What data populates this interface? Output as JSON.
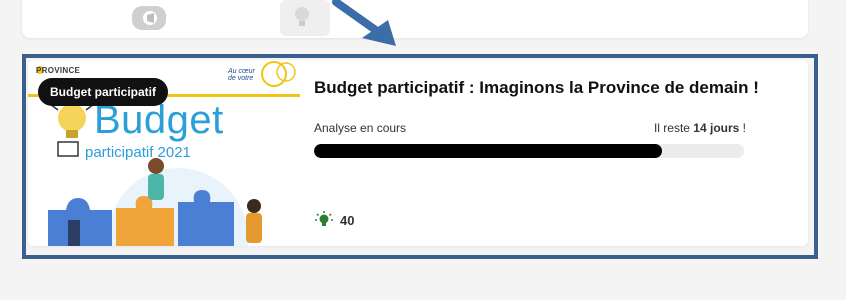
{
  "card": {
    "tag": "Budget participatif",
    "thumbnail": {
      "brand_left": "PROVINCE",
      "brand_right_line1": "Au cœur",
      "brand_right_line2": "de votre",
      "headline": "Budget",
      "subline": "participatif 2021"
    },
    "title": "Budget participatif : Imaginons la Province de demain !",
    "status": "Analyse en cours",
    "remaining_prefix": "Il reste ",
    "remaining_days": "14 jours",
    "remaining_suffix": " !",
    "progress": 0.81,
    "votes_icon": "lightbulb-icon",
    "votes_count": "40"
  },
  "colors": {
    "frame": "#3b5f8e",
    "arrow": "#3b6ea8",
    "accent_blue": "#2a9fd8",
    "accent_yellow": "#f0c419",
    "progress_fill": "#000000"
  }
}
